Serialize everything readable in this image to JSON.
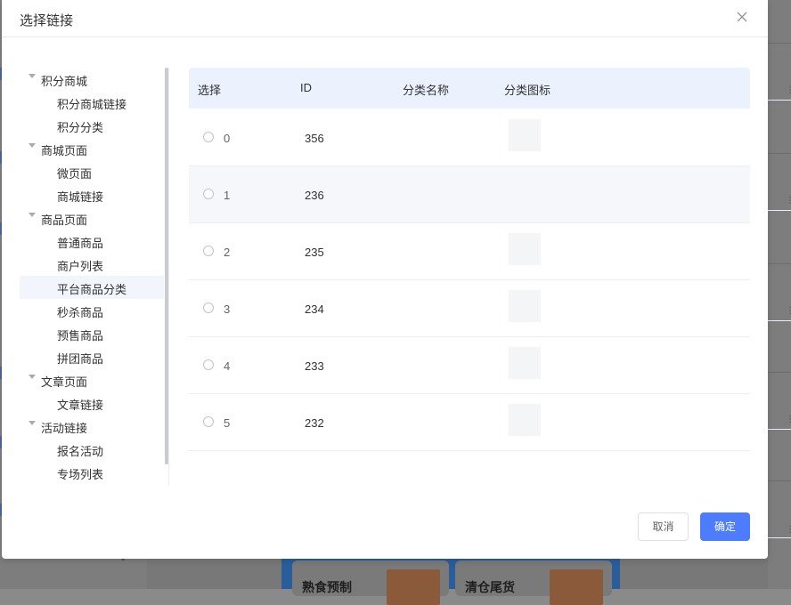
{
  "dialog": {
    "title": "选择链接",
    "cancel_label": "取消",
    "confirm_label": "确定"
  },
  "tree": [
    {
      "label": "积分商城",
      "level": 0,
      "expanded": true
    },
    {
      "label": "积分商城链接",
      "level": 1
    },
    {
      "label": "积分分类",
      "level": 1
    },
    {
      "label": "商城页面",
      "level": 0,
      "expanded": true
    },
    {
      "label": "微页面",
      "level": 1
    },
    {
      "label": "商城链接",
      "level": 1
    },
    {
      "label": "商品页面",
      "level": 0,
      "expanded": true
    },
    {
      "label": "普通商品",
      "level": 1
    },
    {
      "label": "商户列表",
      "level": 1
    },
    {
      "label": "平台商品分类",
      "level": 1,
      "active": true
    },
    {
      "label": "秒杀商品",
      "level": 1
    },
    {
      "label": "预售商品",
      "level": 1
    },
    {
      "label": "拼团商品",
      "level": 1
    },
    {
      "label": "文章页面",
      "level": 0,
      "expanded": true
    },
    {
      "label": "文章链接",
      "level": 1
    },
    {
      "label": "活动链接",
      "level": 0,
      "expanded": true
    },
    {
      "label": "报名活动",
      "level": 1
    },
    {
      "label": "专场列表",
      "level": 1
    }
  ],
  "table": {
    "columns": [
      "选择",
      "ID",
      "分类名称",
      "分类图标"
    ],
    "rows": [
      {
        "radio": "0",
        "id": "356",
        "name": "",
        "has_icon": true
      },
      {
        "radio": "1",
        "id": "236",
        "name": "",
        "has_icon": false
      },
      {
        "radio": "2",
        "id": "235",
        "name": "",
        "has_icon": true
      },
      {
        "radio": "3",
        "id": "234",
        "name": "",
        "has_icon": true
      },
      {
        "radio": "4",
        "id": "233",
        "name": "",
        "has_icon": true
      },
      {
        "radio": "5",
        "id": "232",
        "name": "",
        "has_icon": true
      }
    ]
  },
  "background": {
    "cards": [
      "熟食预制",
      "清仓尾货"
    ]
  },
  "colors": {
    "primary": "#4d7cfe",
    "header_bg": "#ebf2fe",
    "active_tree_bg": "#f2f6fc"
  }
}
